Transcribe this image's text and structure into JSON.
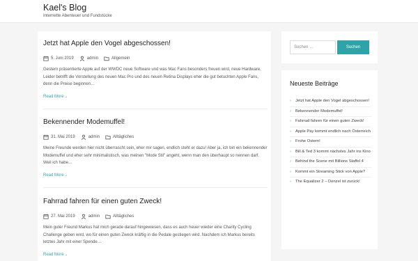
{
  "site": {
    "title": "Kael's Blog",
    "tagline": "Internette Abenteuer und Fundstücke"
  },
  "posts": [
    {
      "title": "Jetzt hat Apple den Vogel abgeschossen!",
      "date": "5. Juni 2019",
      "author": "admin",
      "category": "Allgemein",
      "excerpt": "Gestern präsentierte Apple auf der WWDC neue Software und was Mac Fans besonders freuen wird, neue Hardware. Leider betrifft die Vorstellung des neuen Mac Pro und des neuen Retina Displays eher die gut betuchten Apple Fans, denn die Preise beginnen…",
      "read_more": "Read More→"
    },
    {
      "title": "Bekennender Modemuffel!",
      "date": "31. Mai 2019",
      "author": "admin",
      "category": "Alltägliches",
      "excerpt": "Meine Freunde werden hier nicht überrascht sein, eher mir sagen, endlich steht er dazu! Aber ja, ich bin ein bekennender Modemuffel und eher sehr minimalistisch, was meinen \"Mode Stil\" angeht, wenn man den überhaupt so nennen darf. Weil ich habe…",
      "read_more": "Read More→"
    },
    {
      "title": "Fahrrad fahren für einen guten Zweck!",
      "date": "27. Mai 2019",
      "author": "admin",
      "category": "Alltägliches",
      "excerpt": "Mein guter Freund Markus hat mich gerade darauf hingewiesen, dass es auch heuer wieder eine Charity Cycling Challenge geben wird, wo für einen guten Zweck kräftig in die Pedale gestiegen wird. Nachdem ich Markus bereits letztes Jahr mit einer Spende…",
      "read_more": "Read More→"
    }
  ],
  "search": {
    "placeholder": "Suchen …",
    "button_label": "Suchen"
  },
  "recent": {
    "title": "Neueste Beiträge",
    "items": [
      "Jetzt hat Apple den Vogel abgeschossen!",
      "Bekennender Modemuffel!",
      "Fahrrad fahren für einen guten Zweck!",
      "Apple Pay kommt endlich nach Österreich",
      "Frohe Ostern!",
      "Bill & Ted 3 kommt nächstes Jahr ins Kino",
      "Behind the Scene mit Billions Staffel 4",
      "Kommt ein Streaming Stick von Apple?",
      "The Equalizer 2 – Denzel ist zurück!"
    ]
  },
  "colors": {
    "accent": "#2fa4a8",
    "page_background": "#f5f5f5"
  },
  "icons": {
    "date": "calendar-icon",
    "author": "user-icon",
    "category": "folder-icon",
    "list_bullet": "chevron-right-icon"
  }
}
